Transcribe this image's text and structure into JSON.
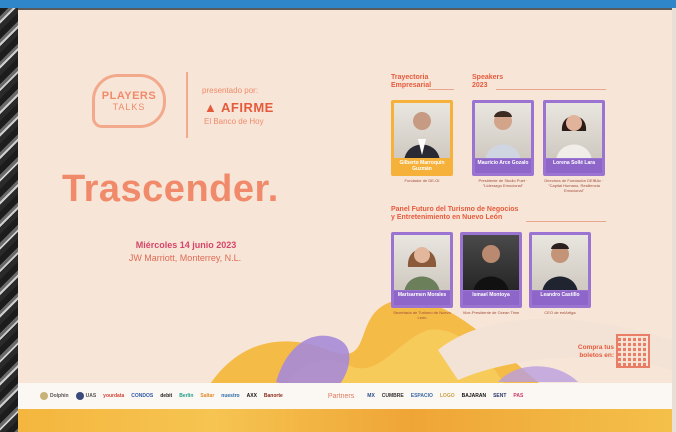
{
  "logo": {
    "line1": "PLAYERS",
    "line2": "TALKS"
  },
  "presenter": {
    "presented_by": "presentado por:",
    "brand": "AFIRME",
    "tagline": "El Banco de Hoy"
  },
  "event": {
    "title": "Trascender.",
    "date": "Miércoles 14 junio 2023",
    "venue": "JW Marriott, Monterrey, N.L."
  },
  "sections": {
    "trayectoria": [
      "Trayectoria",
      "Empresarial"
    ],
    "speakers": [
      "Speakers",
      "2023"
    ],
    "panel": [
      "Panel Futuro del Turismo de Negocios",
      "y Entretenimiento en Nuevo León"
    ]
  },
  "speakers_top": [
    {
      "name": "Gilberto Marroquín Guzmán",
      "role": "Fundador de DE-GI",
      "bar_color": "#f6b13a",
      "frame_color": "#f6b13a"
    },
    {
      "name": "Mauricio Arce Gozalo",
      "role": "Presidente de Studio Puet · \"Liderazgo Emocional\"",
      "bar_color": "#8e66c9",
      "frame_color": "#9b74d2"
    },
    {
      "name": "Lorena Sollé Lara",
      "role": "Directora de Fundación DEIBAc · \"Capital Humano, Resiliencia Emocional\"",
      "bar_color": "#8e66c9",
      "frame_color": "#9b74d2"
    }
  ],
  "panelists": [
    {
      "name": "Marisarmen Morales",
      "role": "Secretaría de Turismo de Nuevo León",
      "bar_color": "#8e66c9"
    },
    {
      "name": "Ismael Montoya",
      "role": "Vice-Presidente de Ocean Time",
      "bar_color": "#8e66c9"
    },
    {
      "name": "Leandro Castillo",
      "role": "CEO de enlArtiga",
      "bar_color": "#8e66c9"
    }
  ],
  "tickets": {
    "line1": "Compra tus",
    "line2": "boletos en:"
  },
  "sponsor_bar": {
    "logos": [
      "Dolphin",
      "UAS",
      "yourdata",
      "CONDOS",
      "debit",
      "Berlin",
      "Saltar",
      "nuestro",
      "AXX",
      "Banorte"
    ],
    "partners_label": "Partners",
    "partner_logos": [
      "MX",
      "CUMBRE",
      "ESPACIO",
      "LOGO",
      "BAJARAN",
      "SENT",
      "PAS"
    ]
  },
  "colors": {
    "poster_bg": "#f7e6d8",
    "accent_salmon": "#f08a6a",
    "accent_purple": "#8e66c9",
    "accent_yellow": "#f6b13a",
    "topbar": "#2f86c8"
  }
}
